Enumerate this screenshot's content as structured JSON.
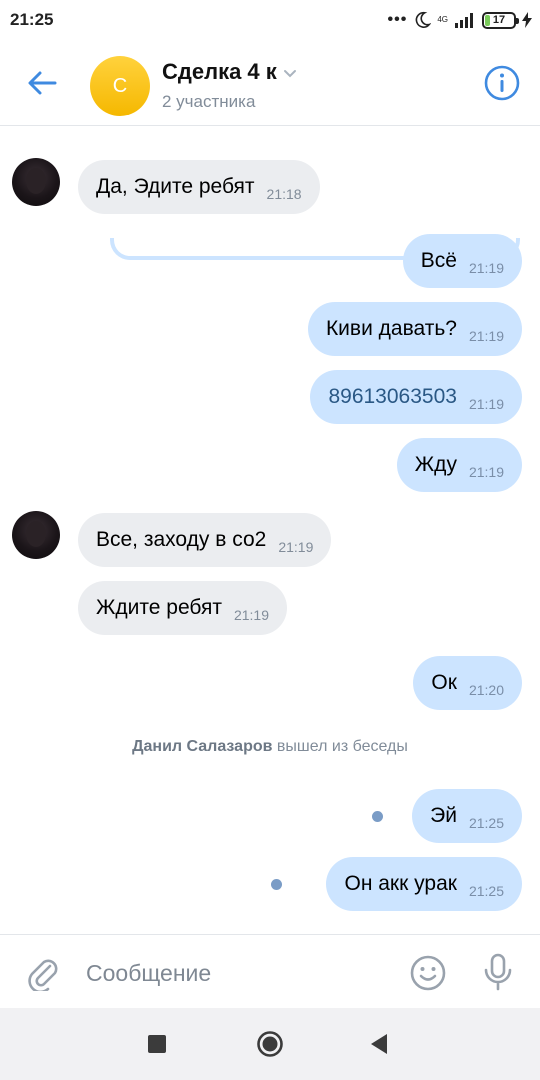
{
  "status_bar": {
    "time": "21:25",
    "dots": "•••",
    "network": "4G",
    "battery": "17"
  },
  "header": {
    "avatar_letter": "С",
    "title": "Сделка 4 к",
    "subtitle": "2 участника"
  },
  "messages": [
    {
      "direction": "in",
      "text": "Да, Эдите ребят",
      "time": "21:18",
      "avatar": true
    },
    {
      "direction": "out",
      "text": "Всё",
      "time": "21:19"
    },
    {
      "direction": "out",
      "text": "Киви давать?",
      "time": "21:19"
    },
    {
      "direction": "out",
      "text": "89613063503",
      "time": "21:19",
      "link": true
    },
    {
      "direction": "out",
      "text": "Жду",
      "time": "21:19"
    },
    {
      "direction": "in",
      "text": "Все, заходу в со2",
      "time": "21:19",
      "avatar": true
    },
    {
      "direction": "in",
      "text": "Ждите ребят",
      "time": "21:19"
    },
    {
      "direction": "out",
      "text": "Ок",
      "time": "21:20"
    },
    {
      "direction": "out",
      "text": "Эй",
      "time": "21:25",
      "unread": true
    },
    {
      "direction": "out",
      "text": "Он акк урак",
      "time": "21:25",
      "unread": true
    }
  ],
  "service_message": {
    "name": "Данил Салазаров",
    "text": "вышел из беседы"
  },
  "composer": {
    "placeholder": "Сообщение"
  },
  "colors": {
    "accent": "#3f8ae0",
    "incoming_bubble": "#ebedf0",
    "outgoing_bubble": "#cce4ff",
    "avatar_yellow": "#f5b800",
    "unread_dot": "#7a9cc6"
  },
  "icons": [
    "back-arrow-icon",
    "chevron-down-icon",
    "info-icon",
    "attach-icon",
    "emoji-icon",
    "mic-icon",
    "moon-icon",
    "signal-icon",
    "battery-icon",
    "charging-icon"
  ]
}
